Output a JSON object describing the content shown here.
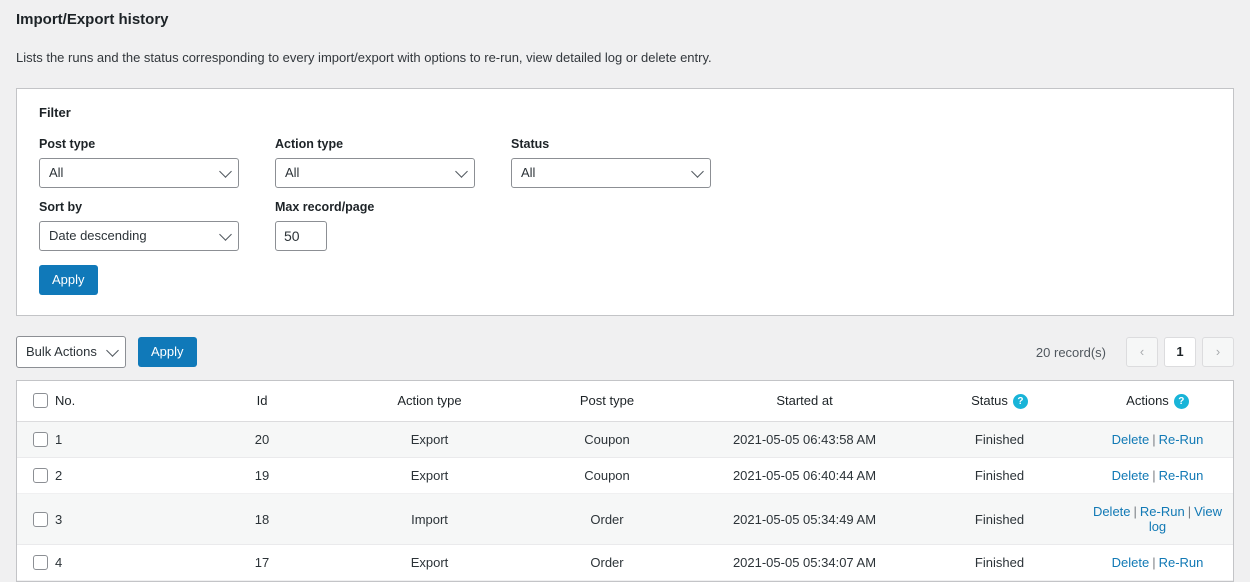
{
  "page": {
    "title": "Import/Export history",
    "description": "Lists the runs and the status corresponding to every import/export with options to re-run, view detailed log or delete entry."
  },
  "filter": {
    "heading": "Filter",
    "post_type": {
      "label": "Post type",
      "value": "All"
    },
    "action_type": {
      "label": "Action type",
      "value": "All"
    },
    "status": {
      "label": "Status",
      "value": "All"
    },
    "sort_by": {
      "label": "Sort by",
      "value": "Date descending"
    },
    "max_record": {
      "label": "Max record/page",
      "value": "50"
    },
    "apply_label": "Apply"
  },
  "actions_bar": {
    "bulk_actions_label": "Bulk Actions",
    "apply_label": "Apply",
    "record_count": "20 record(s)",
    "prev_label": "‹",
    "current_page": "1",
    "next_label": "›"
  },
  "table": {
    "columns": [
      {
        "label": "No.",
        "help": false
      },
      {
        "label": "Id",
        "help": false
      },
      {
        "label": "Action type",
        "help": false
      },
      {
        "label": "Post type",
        "help": false
      },
      {
        "label": "Started at",
        "help": false
      },
      {
        "label": "Status",
        "help": true
      },
      {
        "label": "Actions",
        "help": true
      }
    ],
    "help_glyph": "?",
    "separator": "|",
    "rows": [
      {
        "no": "1",
        "id": "20",
        "action_type": "Export",
        "post_type": "Coupon",
        "started_at": "2021-05-05 06:43:58 AM",
        "status": "Finished",
        "actions": [
          "Delete",
          "Re-Run"
        ]
      },
      {
        "no": "2",
        "id": "19",
        "action_type": "Export",
        "post_type": "Coupon",
        "started_at": "2021-05-05 06:40:44 AM",
        "status": "Finished",
        "actions": [
          "Delete",
          "Re-Run"
        ]
      },
      {
        "no": "3",
        "id": "18",
        "action_type": "Import",
        "post_type": "Order",
        "started_at": "2021-05-05 05:34:49 AM",
        "status": "Finished",
        "actions": [
          "Delete",
          "Re-Run",
          "View log"
        ]
      },
      {
        "no": "4",
        "id": "17",
        "action_type": "Export",
        "post_type": "Order",
        "started_at": "2021-05-05 05:34:07 AM",
        "status": "Finished",
        "actions": [
          "Delete",
          "Re-Run"
        ]
      }
    ]
  },
  "colors": {
    "primary": "#1079b9",
    "link": "#1179b5",
    "help_icon": "#18b4d8",
    "page_bg": "#f0f0f1",
    "row_alt": "#f6f7f7"
  }
}
